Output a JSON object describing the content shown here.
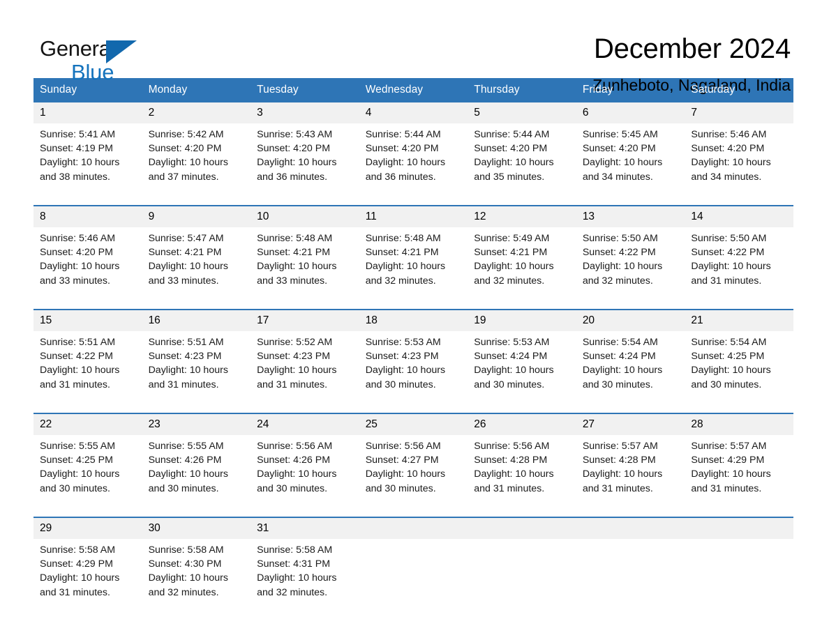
{
  "brand": {
    "line1": "General",
    "line2": "Blue",
    "triangle_color": "#1268ad"
  },
  "header": {
    "title": "December 2024",
    "location": "Zunheboto, Nagaland, India"
  },
  "colors": {
    "header_blue": "#2e75b6",
    "daynum_gray": "#f1f1f1",
    "brand_blue": "#1473bd"
  },
  "weekday_headers": [
    "Sunday",
    "Monday",
    "Tuesday",
    "Wednesday",
    "Thursday",
    "Friday",
    "Saturday"
  ],
  "weeks": [
    [
      {
        "day": "1",
        "sunrise": "Sunrise: 5:41 AM",
        "sunset": "Sunset: 4:19 PM",
        "daylight": "Daylight: 10 hours and 38 minutes."
      },
      {
        "day": "2",
        "sunrise": "Sunrise: 5:42 AM",
        "sunset": "Sunset: 4:20 PM",
        "daylight": "Daylight: 10 hours and 37 minutes."
      },
      {
        "day": "3",
        "sunrise": "Sunrise: 5:43 AM",
        "sunset": "Sunset: 4:20 PM",
        "daylight": "Daylight: 10 hours and 36 minutes."
      },
      {
        "day": "4",
        "sunrise": "Sunrise: 5:44 AM",
        "sunset": "Sunset: 4:20 PM",
        "daylight": "Daylight: 10 hours and 36 minutes."
      },
      {
        "day": "5",
        "sunrise": "Sunrise: 5:44 AM",
        "sunset": "Sunset: 4:20 PM",
        "daylight": "Daylight: 10 hours and 35 minutes."
      },
      {
        "day": "6",
        "sunrise": "Sunrise: 5:45 AM",
        "sunset": "Sunset: 4:20 PM",
        "daylight": "Daylight: 10 hours and 34 minutes."
      },
      {
        "day": "7",
        "sunrise": "Sunrise: 5:46 AM",
        "sunset": "Sunset: 4:20 PM",
        "daylight": "Daylight: 10 hours and 34 minutes."
      }
    ],
    [
      {
        "day": "8",
        "sunrise": "Sunrise: 5:46 AM",
        "sunset": "Sunset: 4:20 PM",
        "daylight": "Daylight: 10 hours and 33 minutes."
      },
      {
        "day": "9",
        "sunrise": "Sunrise: 5:47 AM",
        "sunset": "Sunset: 4:21 PM",
        "daylight": "Daylight: 10 hours and 33 minutes."
      },
      {
        "day": "10",
        "sunrise": "Sunrise: 5:48 AM",
        "sunset": "Sunset: 4:21 PM",
        "daylight": "Daylight: 10 hours and 33 minutes."
      },
      {
        "day": "11",
        "sunrise": "Sunrise: 5:48 AM",
        "sunset": "Sunset: 4:21 PM",
        "daylight": "Daylight: 10 hours and 32 minutes."
      },
      {
        "day": "12",
        "sunrise": "Sunrise: 5:49 AM",
        "sunset": "Sunset: 4:21 PM",
        "daylight": "Daylight: 10 hours and 32 minutes."
      },
      {
        "day": "13",
        "sunrise": "Sunrise: 5:50 AM",
        "sunset": "Sunset: 4:22 PM",
        "daylight": "Daylight: 10 hours and 32 minutes."
      },
      {
        "day": "14",
        "sunrise": "Sunrise: 5:50 AM",
        "sunset": "Sunset: 4:22 PM",
        "daylight": "Daylight: 10 hours and 31 minutes."
      }
    ],
    [
      {
        "day": "15",
        "sunrise": "Sunrise: 5:51 AM",
        "sunset": "Sunset: 4:22 PM",
        "daylight": "Daylight: 10 hours and 31 minutes."
      },
      {
        "day": "16",
        "sunrise": "Sunrise: 5:51 AM",
        "sunset": "Sunset: 4:23 PM",
        "daylight": "Daylight: 10 hours and 31 minutes."
      },
      {
        "day": "17",
        "sunrise": "Sunrise: 5:52 AM",
        "sunset": "Sunset: 4:23 PM",
        "daylight": "Daylight: 10 hours and 31 minutes."
      },
      {
        "day": "18",
        "sunrise": "Sunrise: 5:53 AM",
        "sunset": "Sunset: 4:23 PM",
        "daylight": "Daylight: 10 hours and 30 minutes."
      },
      {
        "day": "19",
        "sunrise": "Sunrise: 5:53 AM",
        "sunset": "Sunset: 4:24 PM",
        "daylight": "Daylight: 10 hours and 30 minutes."
      },
      {
        "day": "20",
        "sunrise": "Sunrise: 5:54 AM",
        "sunset": "Sunset: 4:24 PM",
        "daylight": "Daylight: 10 hours and 30 minutes."
      },
      {
        "day": "21",
        "sunrise": "Sunrise: 5:54 AM",
        "sunset": "Sunset: 4:25 PM",
        "daylight": "Daylight: 10 hours and 30 minutes."
      }
    ],
    [
      {
        "day": "22",
        "sunrise": "Sunrise: 5:55 AM",
        "sunset": "Sunset: 4:25 PM",
        "daylight": "Daylight: 10 hours and 30 minutes."
      },
      {
        "day": "23",
        "sunrise": "Sunrise: 5:55 AM",
        "sunset": "Sunset: 4:26 PM",
        "daylight": "Daylight: 10 hours and 30 minutes."
      },
      {
        "day": "24",
        "sunrise": "Sunrise: 5:56 AM",
        "sunset": "Sunset: 4:26 PM",
        "daylight": "Daylight: 10 hours and 30 minutes."
      },
      {
        "day": "25",
        "sunrise": "Sunrise: 5:56 AM",
        "sunset": "Sunset: 4:27 PM",
        "daylight": "Daylight: 10 hours and 30 minutes."
      },
      {
        "day": "26",
        "sunrise": "Sunrise: 5:56 AM",
        "sunset": "Sunset: 4:28 PM",
        "daylight": "Daylight: 10 hours and 31 minutes."
      },
      {
        "day": "27",
        "sunrise": "Sunrise: 5:57 AM",
        "sunset": "Sunset: 4:28 PM",
        "daylight": "Daylight: 10 hours and 31 minutes."
      },
      {
        "day": "28",
        "sunrise": "Sunrise: 5:57 AM",
        "sunset": "Sunset: 4:29 PM",
        "daylight": "Daylight: 10 hours and 31 minutes."
      }
    ],
    [
      {
        "day": "29",
        "sunrise": "Sunrise: 5:58 AM",
        "sunset": "Sunset: 4:29 PM",
        "daylight": "Daylight: 10 hours and 31 minutes."
      },
      {
        "day": "30",
        "sunrise": "Sunrise: 5:58 AM",
        "sunset": "Sunset: 4:30 PM",
        "daylight": "Daylight: 10 hours and 32 minutes."
      },
      {
        "day": "31",
        "sunrise": "Sunrise: 5:58 AM",
        "sunset": "Sunset: 4:31 PM",
        "daylight": "Daylight: 10 hours and 32 minutes."
      },
      {
        "day": "",
        "sunrise": "",
        "sunset": "",
        "daylight": ""
      },
      {
        "day": "",
        "sunrise": "",
        "sunset": "",
        "daylight": ""
      },
      {
        "day": "",
        "sunrise": "",
        "sunset": "",
        "daylight": ""
      },
      {
        "day": "",
        "sunrise": "",
        "sunset": "",
        "daylight": ""
      }
    ]
  ]
}
